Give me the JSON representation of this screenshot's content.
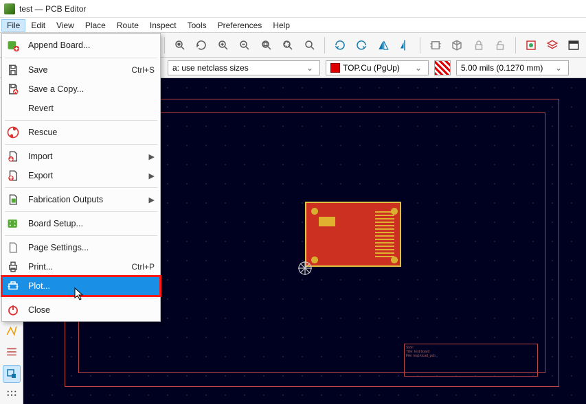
{
  "window": {
    "title": "test — PCB Editor"
  },
  "menubar": {
    "items": [
      "File",
      "Edit",
      "View",
      "Place",
      "Route",
      "Inspect",
      "Tools",
      "Preferences",
      "Help"
    ],
    "active_index": 0
  },
  "secondbar": {
    "track_combo": "a: use netclass sizes",
    "layer_combo": "TOP.Cu (PgUp)",
    "grid_combo": "5.00 mils (0.1270 mm)"
  },
  "file_menu": {
    "items": [
      {
        "icon": "board-plus-icon",
        "label": "Append Board...",
        "shortcut": "",
        "submenu": false
      },
      {
        "divider": true
      },
      {
        "icon": "save-icon",
        "label": "Save",
        "shortcut": "Ctrl+S",
        "submenu": false
      },
      {
        "icon": "save-copy-icon",
        "label": "Save a Copy...",
        "shortcut": "",
        "submenu": false
      },
      {
        "icon": "blank-icon",
        "label": "Revert",
        "shortcut": "",
        "submenu": false
      },
      {
        "divider": true
      },
      {
        "icon": "rescue-icon",
        "label": "Rescue",
        "shortcut": "",
        "submenu": false
      },
      {
        "divider": true
      },
      {
        "icon": "import-icon",
        "label": "Import",
        "shortcut": "",
        "submenu": true
      },
      {
        "icon": "export-icon",
        "label": "Export",
        "shortcut": "",
        "submenu": true
      },
      {
        "divider": true
      },
      {
        "icon": "fab-icon",
        "label": "Fabrication Outputs",
        "shortcut": "",
        "submenu": true
      },
      {
        "divider": true
      },
      {
        "icon": "board-setup-icon",
        "label": "Board Setup...",
        "shortcut": "",
        "submenu": false
      },
      {
        "divider": true
      },
      {
        "icon": "page-settings-icon",
        "label": "Page Settings...",
        "shortcut": "",
        "submenu": false
      },
      {
        "icon": "print-icon",
        "label": "Print...",
        "shortcut": "Ctrl+P",
        "submenu": false
      },
      {
        "icon": "plot-icon",
        "label": "Plot...",
        "shortcut": "",
        "submenu": false,
        "highlight": true,
        "boxed": true
      },
      {
        "divider": true
      },
      {
        "icon": "power-icon",
        "label": "Close",
        "shortcut": "",
        "submenu": false
      }
    ]
  },
  "titleblock": {
    "line1": "Size:",
    "line2": "Title: test board",
    "line3": "File: test.kicad_pcb"
  },
  "colors": {
    "accent": "#1a8fe6",
    "highlight_box": "#ff1a1a",
    "copper": "#cc3020",
    "outline": "#b44"
  }
}
